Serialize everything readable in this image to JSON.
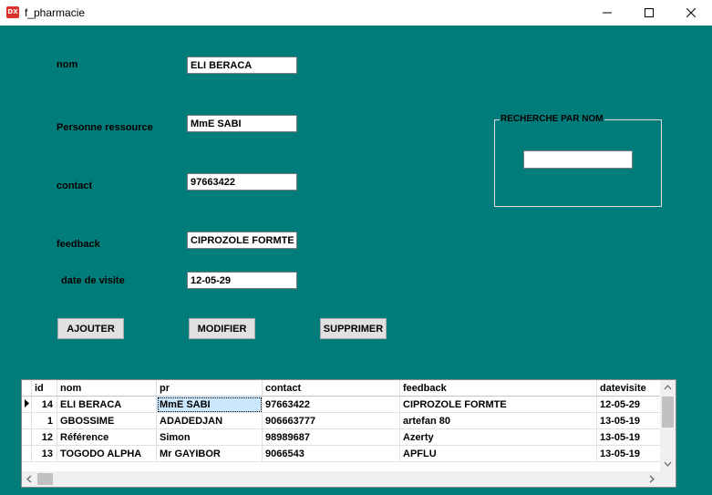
{
  "window": {
    "title": "f_pharmacie",
    "icon_text": "DX"
  },
  "form": {
    "nom_label": "nom",
    "nom_value": "ELI BERACA",
    "personne_label": "Personne ressource",
    "personne_value": "MmE SABI",
    "contact_label": "contact",
    "contact_value": "97663422",
    "feedback_label": "feedback",
    "feedback_value": "CIPROZOLE FORMTE",
    "date_label": "date de visite",
    "date_value": "12-05-29"
  },
  "buttons": {
    "ajouter": "AJOUTER",
    "modifier": "MODIFIER",
    "supprimer": "SUPPRIMER"
  },
  "search": {
    "group_title": "RECHERCHE PAR NOM",
    "value": ""
  },
  "grid": {
    "columns": [
      "id",
      "nom",
      "pr",
      "contact",
      "feedback",
      "datevisite"
    ],
    "rows": [
      [
        "14",
        "ELI BERACA",
        "MmE SABI",
        "97663422",
        "CIPROZOLE FORMTE",
        "12-05-29"
      ],
      [
        "1",
        "GBOSSIME",
        "ADADEDJAN",
        "906663777",
        "artefan 80",
        "13-05-19"
      ],
      [
        "12",
        "Référence",
        "Simon",
        "98989687",
        "Azerty",
        "13-05-19"
      ],
      [
        "13",
        "TOGODO ALPHA",
        "Mr GAYIBOR",
        "9066543",
        "APFLU",
        "13-05-19"
      ]
    ]
  },
  "colors": {
    "background": "#007c7a",
    "selection": "#cce8ff"
  }
}
